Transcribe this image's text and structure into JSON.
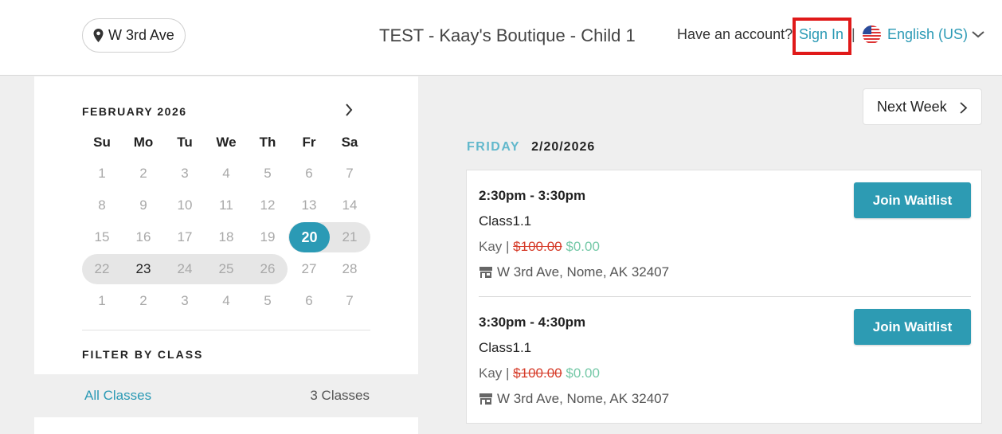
{
  "header": {
    "location_label": "W 3rd Ave",
    "studio_title": "TEST - Kaay's Boutique - Child 1",
    "account_prompt": "Have an account?",
    "sign_in_label": "Sign In",
    "separator": "|",
    "language_label": "English (US)"
  },
  "calendar": {
    "month_title": "FEBRUARY 2026",
    "weekdays": [
      "Su",
      "Mo",
      "Tu",
      "We",
      "Th",
      "Fr",
      "Sa"
    ],
    "weeks": [
      [
        "1",
        "2",
        "3",
        "4",
        "5",
        "6",
        "7"
      ],
      [
        "8",
        "9",
        "10",
        "11",
        "12",
        "13",
        "14"
      ],
      [
        "15",
        "16",
        "17",
        "18",
        "19",
        "20",
        "21"
      ],
      [
        "22",
        "23",
        "24",
        "25",
        "26",
        "27",
        "28"
      ],
      [
        "1",
        "2",
        "3",
        "4",
        "5",
        "6",
        "7"
      ]
    ],
    "selected_day": "20",
    "current_day": "23"
  },
  "filter": {
    "title": "FILTER BY CLASS",
    "items": [
      {
        "name": "All Classes",
        "count": "3 Classes"
      }
    ]
  },
  "main": {
    "next_week_label": "Next Week",
    "day_name": "FRIDAY",
    "day_date": "2/20/2026",
    "sessions": [
      {
        "time": "2:30pm - 3:30pm",
        "class_name": "Class1.1",
        "instructor": "Kay",
        "price_sep": " | ",
        "old_price": "$100.00",
        "new_price": "$0.00",
        "location": "W 3rd Ave, Nome, AK 32407",
        "button_label": "Join Waitlist"
      },
      {
        "time": "3:30pm - 4:30pm",
        "class_name": "Class1.1",
        "instructor": "Kay",
        "price_sep": " | ",
        "old_price": "$100.00",
        "new_price": "$0.00",
        "location": "W 3rd Ave, Nome, AK 32407",
        "button_label": "Join Waitlist"
      }
    ]
  },
  "colors": {
    "accent": "#2b9ab5",
    "highlight_box": "#e01919",
    "old_price": "#d63c2a",
    "new_price": "#76c9a8"
  }
}
